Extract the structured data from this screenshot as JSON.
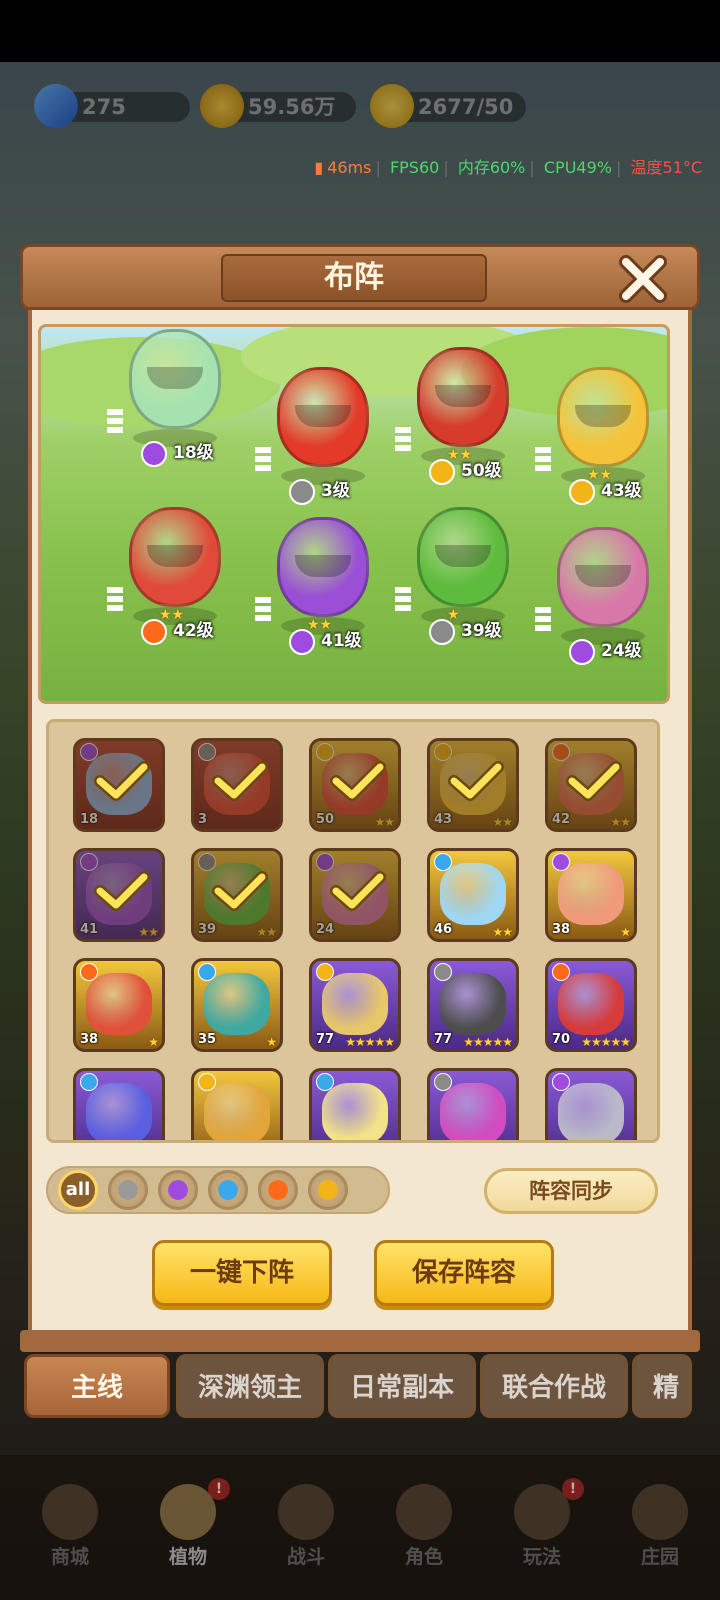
{
  "currency": {
    "gems": "275",
    "coins": "59.56万",
    "energy": "2677/50"
  },
  "perf": {
    "ping": "46ms",
    "fps": "FPS60",
    "mem": "内存60%",
    "cpu": "CPU49%",
    "temp": "温度51°C",
    "colors": {
      "ping": "#ff7b3a",
      "fps": "#4ad96b",
      "mem": "#4ad96b",
      "cpu": "#4ad96b",
      "temp": "#ff4d4d"
    }
  },
  "dialog": {
    "title": "布阵",
    "close_icon": "close-x-icon"
  },
  "lineup": [
    {
      "name": "flower-maiden",
      "level": "18级",
      "element": "poison",
      "stars": 0,
      "color": "#a6e2b0"
    },
    {
      "name": "chili-brawler",
      "level": "3级",
      "element": "blade",
      "stars": 0,
      "color": "#e33a2a"
    },
    {
      "name": "iron-pepper",
      "level": "50级",
      "element": "lightning",
      "stars": 2,
      "color": "#d63b2c"
    },
    {
      "name": "golden-knight",
      "level": "43级",
      "element": "lightning",
      "stars": 2,
      "color": "#f4c33a"
    },
    {
      "name": "dragon-warlord",
      "level": "42级",
      "element": "fire",
      "stars": 2,
      "color": "#e04a3a"
    },
    {
      "name": "witch-sprout",
      "level": "41级",
      "element": "poison",
      "stars": 2,
      "color": "#9a4fd6"
    },
    {
      "name": "melon-tank",
      "level": "39级",
      "element": "blade",
      "stars": 1,
      "color": "#5dbb3e"
    },
    {
      "name": "titan-onion",
      "level": "24级",
      "element": "poison",
      "stars": 0,
      "color": "#d878a8"
    }
  ],
  "roster": [
    {
      "level": "18",
      "element": "poison",
      "stars": 0,
      "selected": true,
      "frame": "red",
      "art": "#8fb6e8"
    },
    {
      "level": "3",
      "element": "blade",
      "stars": 0,
      "selected": true,
      "frame": "red",
      "art": "#e04a3a"
    },
    {
      "level": "50",
      "element": "lightning",
      "stars": 2,
      "selected": true,
      "frame": "gold",
      "art": "#e04a3a"
    },
    {
      "level": "43",
      "element": "lightning",
      "stars": 2,
      "selected": true,
      "frame": "gold",
      "art": "#f4c33a"
    },
    {
      "level": "42",
      "element": "fire",
      "stars": 2,
      "selected": true,
      "frame": "gold",
      "art": "#e06a4a"
    },
    {
      "level": "41",
      "element": "poison",
      "stars": 2,
      "selected": true,
      "frame": "purple",
      "art": "#9a4fd6"
    },
    {
      "level": "39",
      "element": "blade",
      "stars": 2,
      "selected": true,
      "frame": "gold",
      "art": "#5dbb3e"
    },
    {
      "level": "24",
      "element": "poison",
      "stars": 0,
      "selected": true,
      "frame": "gold",
      "art": "#d878a8"
    },
    {
      "level": "46",
      "element": "water",
      "stars": 2,
      "selected": false,
      "frame": "gold",
      "art": "#9fd7f2"
    },
    {
      "level": "38",
      "element": "poison",
      "stars": 1,
      "selected": false,
      "frame": "gold",
      "art": "#f09a7a"
    },
    {
      "level": "38",
      "element": "fire",
      "stars": 1,
      "selected": false,
      "frame": "gold",
      "art": "#e0503a"
    },
    {
      "level": "35",
      "element": "water",
      "stars": 1,
      "selected": false,
      "frame": "gold",
      "art": "#3fa9a0"
    },
    {
      "level": "77",
      "element": "lightning",
      "stars": 5,
      "selected": false,
      "frame": "purple",
      "art": "#e8c76a"
    },
    {
      "level": "77",
      "element": "blade",
      "stars": 5,
      "selected": false,
      "frame": "purple",
      "art": "#4d4d4d"
    },
    {
      "level": "70",
      "element": "fire",
      "stars": 5,
      "selected": false,
      "frame": "purple",
      "art": "#d63b3b"
    },
    {
      "level": "",
      "element": "water",
      "stars": 0,
      "selected": false,
      "frame": "purple",
      "art": "#5a5fe0"
    },
    {
      "level": "",
      "element": "lightning",
      "stars": 0,
      "selected": false,
      "frame": "gold",
      "art": "#e2a53a"
    },
    {
      "level": "",
      "element": "water",
      "stars": 0,
      "selected": false,
      "frame": "purple",
      "art": "#f2e28a"
    },
    {
      "level": "",
      "element": "blade",
      "stars": 0,
      "selected": false,
      "frame": "purple",
      "art": "#d04cc0"
    },
    {
      "level": "",
      "element": "poison",
      "stars": 0,
      "selected": false,
      "frame": "purple",
      "art": "#b9b9c9"
    }
  ],
  "element_colors": {
    "poison": "#a04be0",
    "blade": "#8a8a8a",
    "lightning": "#f2b417",
    "fire": "#ff6a1a",
    "water": "#3aa8ea"
  },
  "filters": [
    {
      "label": "all",
      "icon": "all-filter"
    },
    {
      "label": "",
      "icon": "sword-icon"
    },
    {
      "label": "",
      "icon": "poison-flask-icon"
    },
    {
      "label": "",
      "icon": "water-drop-icon"
    },
    {
      "label": "",
      "icon": "flame-icon"
    },
    {
      "label": "",
      "icon": "lightning-icon"
    }
  ],
  "buttons": {
    "sync": "阵容同步",
    "unload_all": "一键下阵",
    "save": "保存阵容"
  },
  "tabs": [
    {
      "label": "主线",
      "active": true
    },
    {
      "label": "深渊领主",
      "active": false
    },
    {
      "label": "日常副本",
      "active": false
    },
    {
      "label": "联合作战",
      "active": false
    },
    {
      "label": "精",
      "active": false
    }
  ],
  "nav": [
    {
      "label": "商城",
      "active": false,
      "badge": ""
    },
    {
      "label": "植物",
      "active": true,
      "badge": "!"
    },
    {
      "label": "战斗",
      "active": false,
      "badge": ""
    },
    {
      "label": "角色",
      "active": false,
      "badge": ""
    },
    {
      "label": "玩法",
      "active": false,
      "badge": "!"
    },
    {
      "label": "庄园",
      "active": false,
      "badge": ""
    }
  ]
}
